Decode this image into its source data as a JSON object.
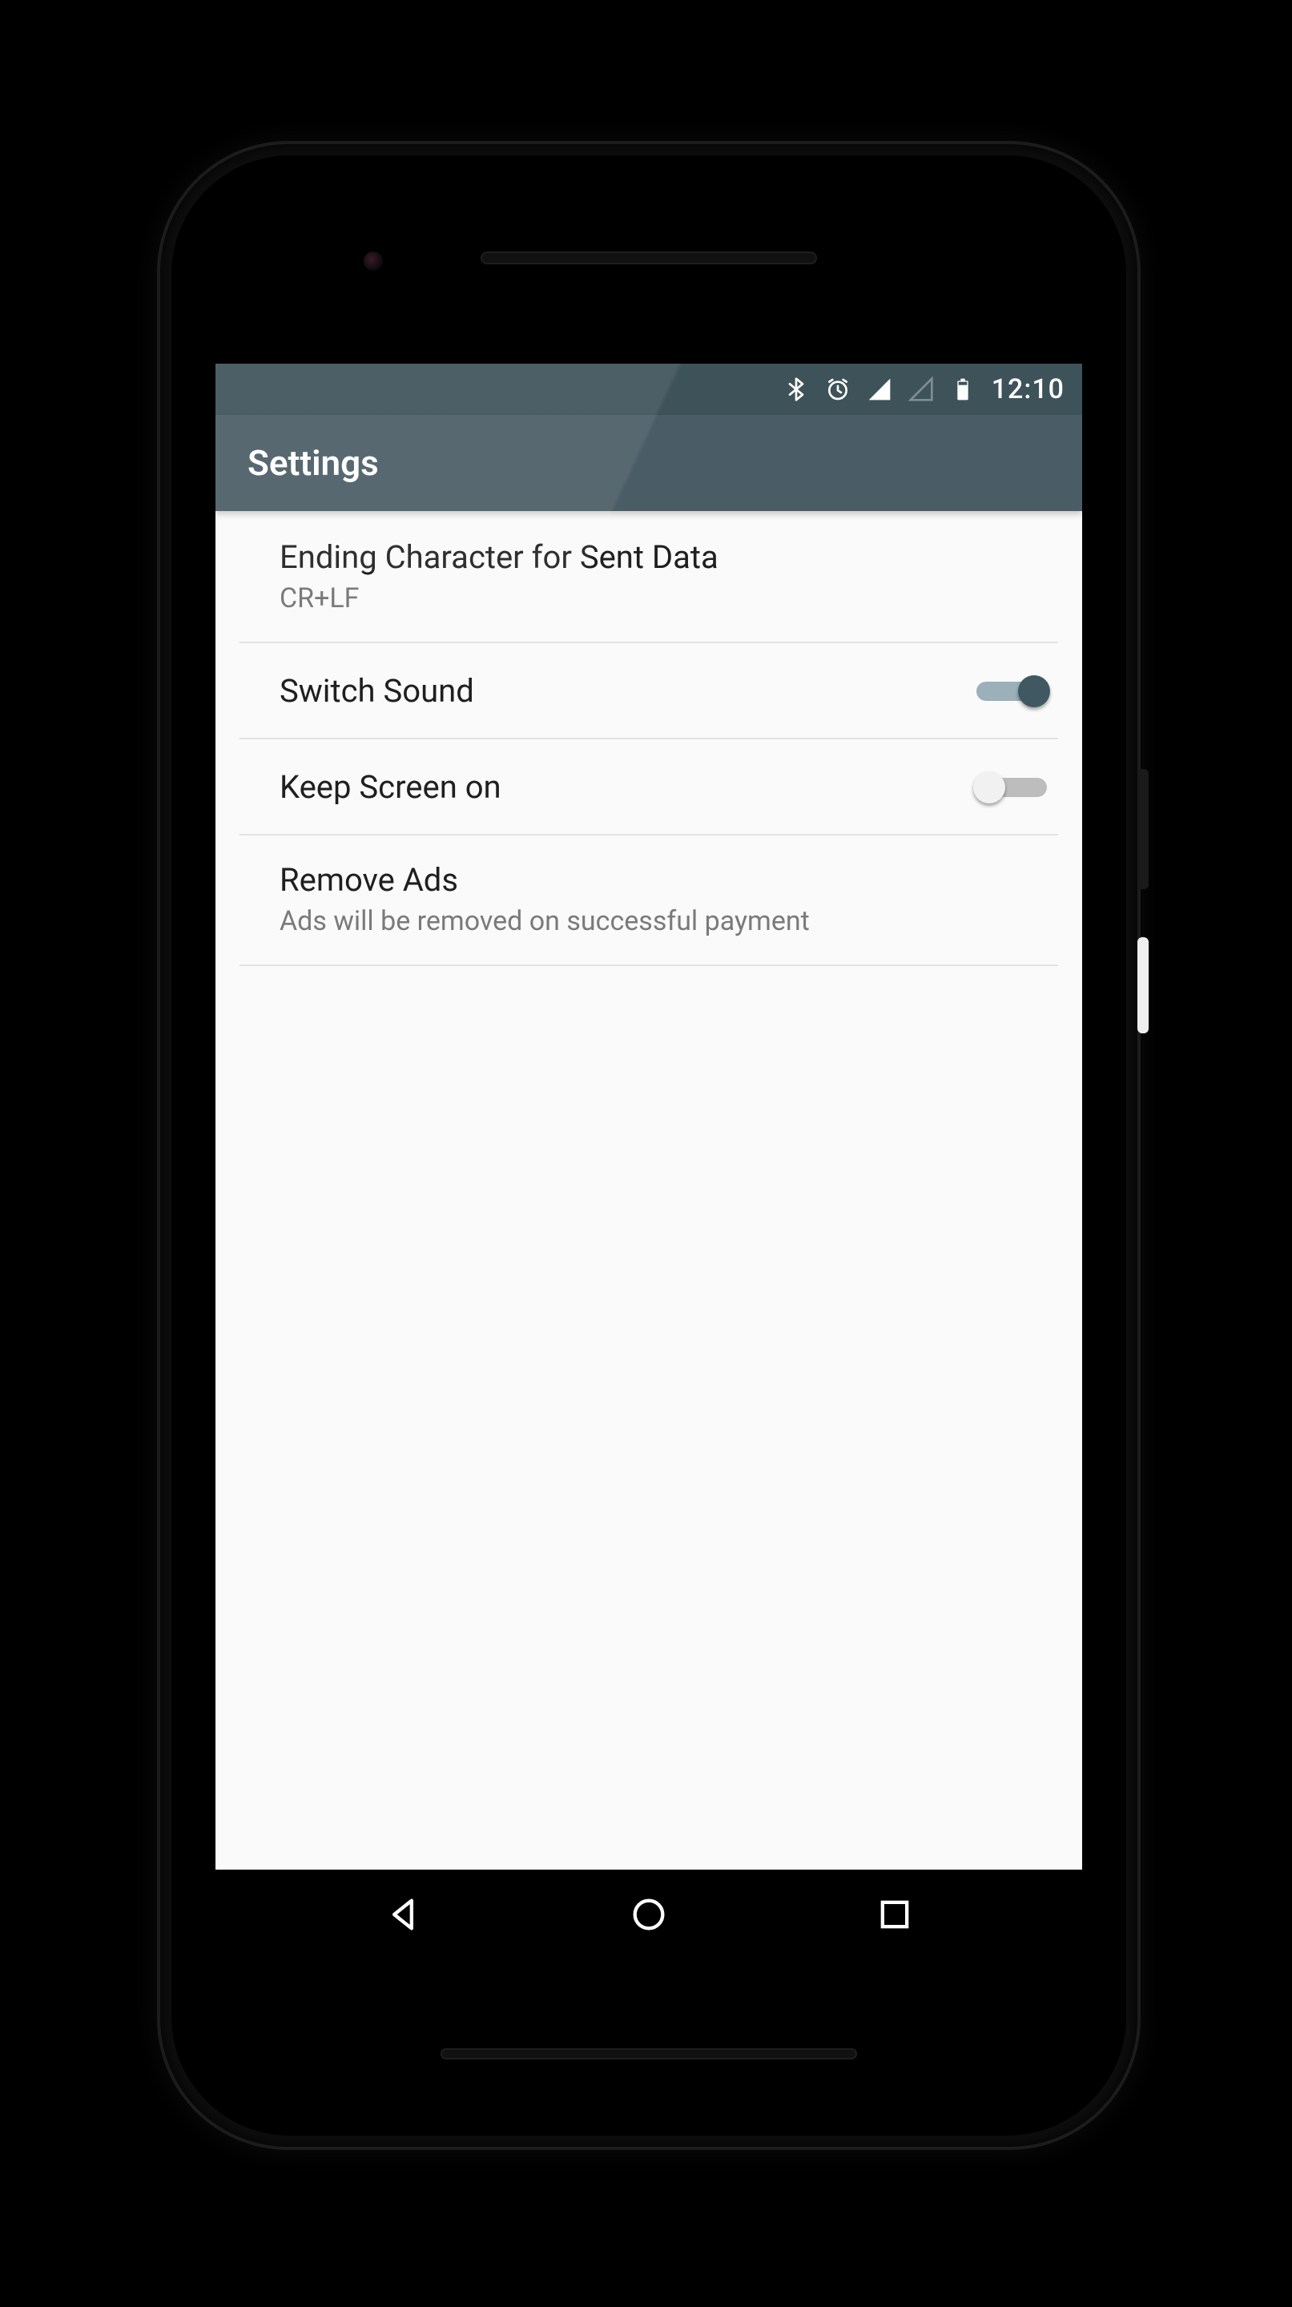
{
  "status": {
    "time": "12:10"
  },
  "appbar": {
    "title": "Settings"
  },
  "items": {
    "ending": {
      "title": "Ending Character for Sent Data",
      "value": "CR+LF"
    },
    "sound": {
      "title": "Switch Sound",
      "on": true
    },
    "keep": {
      "title": "Keep Screen on",
      "on": false
    },
    "ads": {
      "title": "Remove Ads",
      "subtitle": "Ads will be removed on successful payment"
    }
  }
}
